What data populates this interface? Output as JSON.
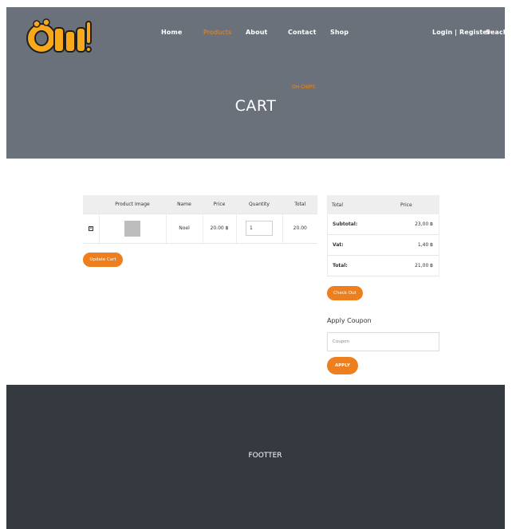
{
  "header": {
    "logo_text": "Ohm!",
    "nav": {
      "home": "Home",
      "products": "Products",
      "about": "About",
      "contact": "Contact",
      "shop": "Shop",
      "login_register": "Login | Register",
      "search": "Seach"
    },
    "eyebrow": "OH CHIPS",
    "title": "CART"
  },
  "cart": {
    "columns": [
      "Product Image",
      "Name",
      "Price",
      "Quantity",
      "Total"
    ],
    "item": {
      "name": "Noel",
      "price": "20.00 ฿",
      "quantity": "1",
      "total": "20.00"
    },
    "update_button": "Update Cart"
  },
  "totals": {
    "header_total": "Total",
    "header_price": "Price",
    "subtotal_label": "Subtotal:",
    "subtotal_value": "23,00 ฿",
    "vat_label": "Vat:",
    "vat_value": "1,40 ฿",
    "total_label": "Total:",
    "total_value": "21,00 ฿",
    "checkout_button": "Check Out"
  },
  "coupon": {
    "title": "Apply Coupon",
    "placeholder": "Coupon",
    "apply_button": "APPLY"
  },
  "footer": {
    "text": "FOOTTER"
  },
  "colors": {
    "accent": "#ee7f1e",
    "hero_bg": "#6a717b",
    "footer_bg": "#353940"
  }
}
